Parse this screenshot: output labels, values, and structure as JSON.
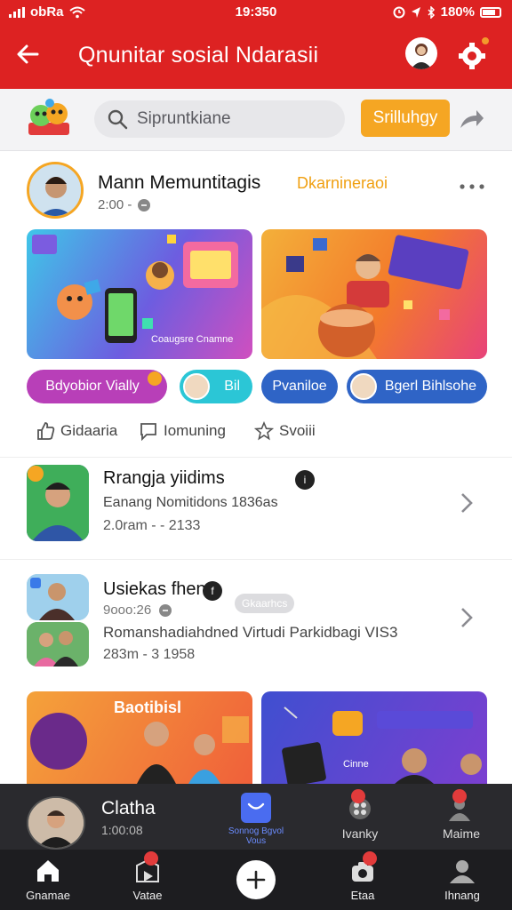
{
  "status": {
    "carrier": "obRa",
    "time": "19:350",
    "battery": "180%"
  },
  "header": {
    "title": "Qnunitar sosial Ndarasii"
  },
  "search": {
    "placeholder": "Sipruntkiane",
    "submit_label": "Srilluhgy"
  },
  "post": {
    "author": "Mann Memuntitagis",
    "time": "2:00 -",
    "tag": "Dkarnineraoi",
    "banner_1_caption": "Coaugsre Cnamne",
    "banner_2_caption": "",
    "chips": [
      "Bdyobior Vially",
      "Bil",
      "Pvaniloe",
      "Bgerl Bihlsohe"
    ],
    "actions": [
      "Gidaaria",
      "Iomuning",
      "Svoiii"
    ]
  },
  "list": [
    {
      "title": "Rrangja yiidims",
      "subtitle": "Eanang Nomitidons 1836as",
      "time": "2.0ram - - 2133"
    },
    {
      "title": "Usiekas fhen",
      "meta": "9ooo:26",
      "label": "Gkaarhcs",
      "subtitle": "Romanshadiahdned Virtudi Parkidbagi VIS3",
      "time": "283m - 3 1958"
    }
  ],
  "cards": {
    "card_1_title": "Baotibisl",
    "card_2_badge": "Cinne"
  },
  "player": {
    "title": "Clatha",
    "time": "1:00:08",
    "center_label": "Sonnog Bgvol Vous",
    "tab_1": "Ivanky",
    "tab_2": "Maime"
  },
  "nav": {
    "home": "Gnamae",
    "videos": "Vatae",
    "camera": "Etaa",
    "profile": "Ihnang"
  },
  "colors": {
    "header": "#dd2222",
    "accent": "#f5a623",
    "chip_purple": "#b83fb8",
    "chip_cyan": "#2bc6d6",
    "chip_blue": "#2f64c6"
  }
}
